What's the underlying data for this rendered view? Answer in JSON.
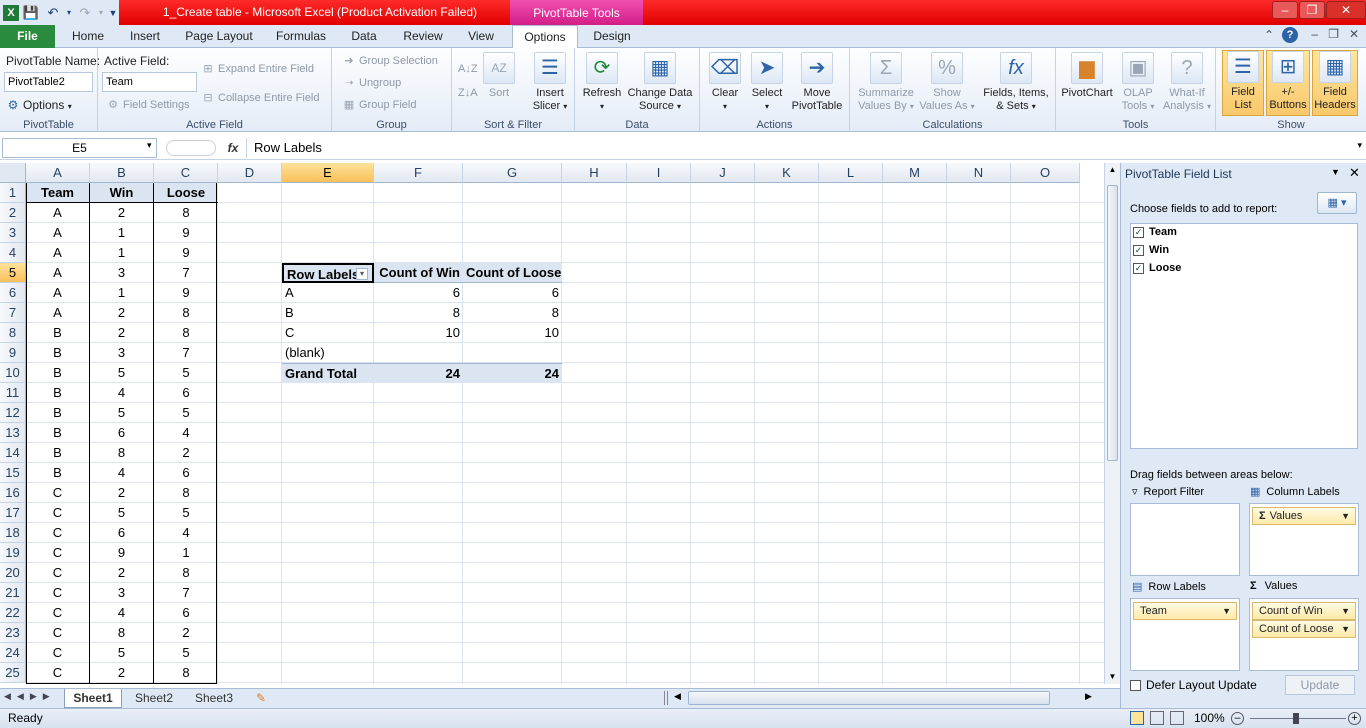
{
  "window": {
    "title": "1_Create table - Microsoft Excel (Product Activation Failed)",
    "contextual_tab_group": "PivotTable Tools"
  },
  "tabs": [
    "File",
    "Home",
    "Insert",
    "Page Layout",
    "Formulas",
    "Data",
    "Review",
    "View",
    "Options",
    "Design"
  ],
  "ribbon": {
    "pivottable": {
      "name_label": "PivotTable Name:",
      "name_value": "PivotTable2",
      "options_label": "Options",
      "group_label": "PivotTable"
    },
    "active_field": {
      "label": "Active Field:",
      "value": "Team",
      "field_settings": "Field Settings",
      "expand": "Expand Entire Field",
      "collapse": "Collapse Entire Field",
      "group_label": "Active Field"
    },
    "group": {
      "group_selection": "Group Selection",
      "ungroup": "Ungroup",
      "group_field": "Group Field",
      "group_label": "Group"
    },
    "sort": {
      "sort": "Sort",
      "group_label": "Sort & Filter"
    },
    "insert_slicer": {
      "line1": "Insert",
      "line2": "Slicer"
    },
    "data": {
      "refresh": "Refresh",
      "change_source_1": "Change Data",
      "change_source_2": "Source",
      "group_label": "Data"
    },
    "actions": {
      "clear": "Clear",
      "select": "Select",
      "move_1": "Move",
      "move_2": "PivotTable",
      "group_label": "Actions"
    },
    "calculations": {
      "summarize_1": "Summarize",
      "summarize_2": "Values By",
      "show_1": "Show",
      "show_2": "Values As",
      "fields_1": "Fields, Items,",
      "fields_2": "& Sets",
      "group_label": "Calculations"
    },
    "tools": {
      "pivotchart": "PivotChart",
      "olap_1": "OLAP",
      "olap_2": "Tools",
      "whatif_1": "What-If",
      "whatif_2": "Analysis",
      "group_label": "Tools"
    },
    "show": {
      "field_list_1": "Field",
      "field_list_2": "List",
      "buttons_1": "+/-",
      "buttons_2": "Buttons",
      "headers_1": "Field",
      "headers_2": "Headers",
      "group_label": "Show"
    }
  },
  "formula_bar": {
    "name_box": "E5",
    "fx": "fx",
    "content": "Row Labels"
  },
  "columns": [
    "A",
    "B",
    "C",
    "D",
    "E",
    "F",
    "G",
    "H",
    "I",
    "J",
    "K",
    "L",
    "M",
    "N",
    "O"
  ],
  "rows": [
    "1",
    "2",
    "3",
    "4",
    "5",
    "6",
    "7",
    "8",
    "9",
    "10",
    "11",
    "12",
    "13",
    "14",
    "15",
    "16",
    "17",
    "18",
    "19",
    "20",
    "21",
    "22",
    "23",
    "24",
    "25"
  ],
  "source_table": {
    "headers": [
      "Team",
      "Win",
      "Loose"
    ],
    "rows": [
      [
        "A",
        "2",
        "8"
      ],
      [
        "A",
        "1",
        "9"
      ],
      [
        "A",
        "1",
        "9"
      ],
      [
        "A",
        "3",
        "7"
      ],
      [
        "A",
        "1",
        "9"
      ],
      [
        "A",
        "2",
        "8"
      ],
      [
        "B",
        "2",
        "8"
      ],
      [
        "B",
        "3",
        "7"
      ],
      [
        "B",
        "5",
        "5"
      ],
      [
        "B",
        "4",
        "6"
      ],
      [
        "B",
        "5",
        "5"
      ],
      [
        "B",
        "6",
        "4"
      ],
      [
        "B",
        "8",
        "2"
      ],
      [
        "B",
        "4",
        "6"
      ],
      [
        "C",
        "2",
        "8"
      ],
      [
        "C",
        "5",
        "5"
      ],
      [
        "C",
        "6",
        "4"
      ],
      [
        "C",
        "9",
        "1"
      ],
      [
        "C",
        "2",
        "8"
      ],
      [
        "C",
        "3",
        "7"
      ],
      [
        "C",
        "4",
        "6"
      ],
      [
        "C",
        "8",
        "2"
      ],
      [
        "C",
        "5",
        "5"
      ],
      [
        "C",
        "2",
        "8"
      ]
    ]
  },
  "pivot": {
    "headers": [
      "Row Labels",
      "Count of Win",
      "Count of Loose"
    ],
    "rows": [
      [
        "A",
        "6",
        "6"
      ],
      [
        "B",
        "8",
        "8"
      ],
      [
        "C",
        "10",
        "10"
      ],
      [
        "(blank)",
        "",
        ""
      ]
    ],
    "total": [
      "Grand Total",
      "24",
      "24"
    ]
  },
  "sheets": [
    "Sheet1",
    "Sheet2",
    "Sheet3"
  ],
  "status": {
    "ready": "Ready",
    "zoom": "100%"
  },
  "field_list": {
    "title": "PivotTable Field List",
    "choose": "Choose fields to add to report:",
    "fields": [
      "Team",
      "Win",
      "Loose"
    ],
    "drag_label": "Drag fields between areas below:",
    "report_filter": "Report Filter",
    "column_labels": "Column Labels",
    "row_labels": "Row Labels",
    "values": "Values",
    "column_chip": "Values",
    "row_chip": "Team",
    "value_chips": [
      "Count of Win",
      "Count of Loose"
    ],
    "defer": "Defer Layout Update",
    "update": "Update"
  }
}
